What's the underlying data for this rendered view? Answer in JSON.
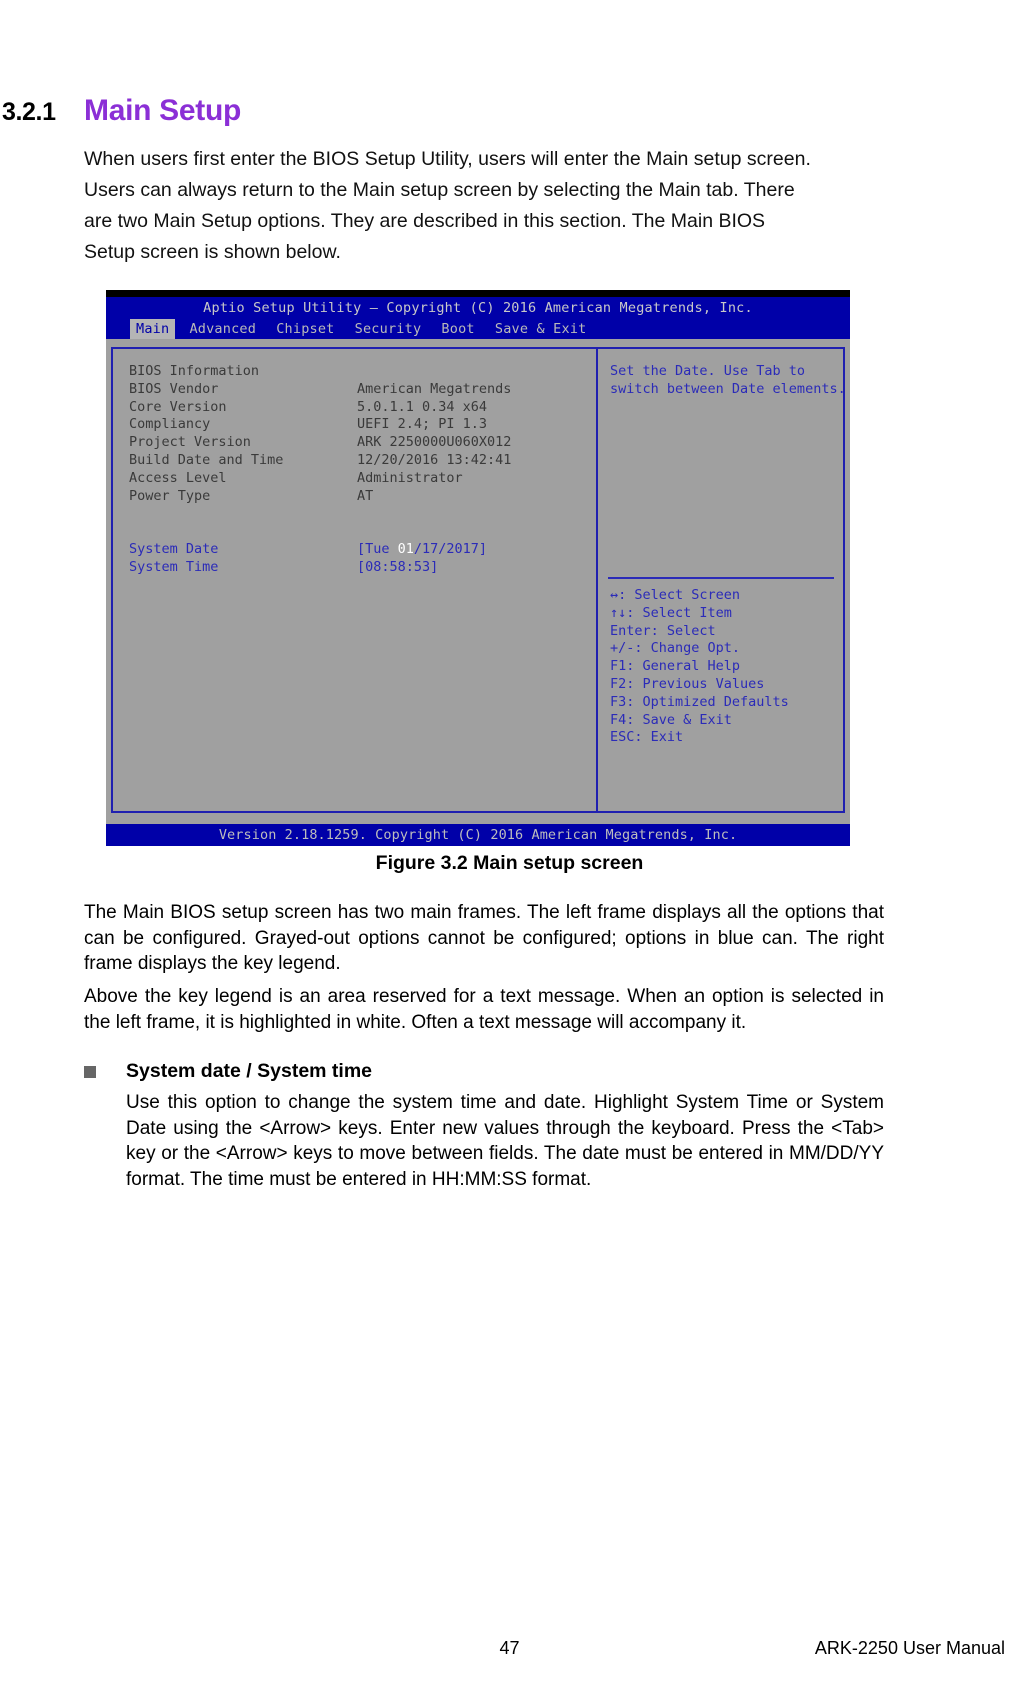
{
  "section": {
    "number": "3.2.1",
    "title": "Main Setup",
    "accent_color": "#8b2fd6",
    "intro_lines": [
      "When users first enter the BIOS Setup Utility, users will enter the Main setup screen.",
      "Users can always return to the Main setup screen by selecting the Main tab. There",
      "are two Main Setup options. They are described in this section. The Main BIOS",
      "Setup screen is shown below."
    ]
  },
  "bios": {
    "title": "Aptio Setup Utility – Copyright (C) 2016 American Megatrends, Inc.",
    "tabs": [
      {
        "label": "Main",
        "active": true
      },
      {
        "label": "Advanced",
        "active": false
      },
      {
        "label": "Chipset",
        "active": false
      },
      {
        "label": "Security",
        "active": false
      },
      {
        "label": "Boot",
        "active": false
      },
      {
        "label": "Save & Exit",
        "active": false
      }
    ],
    "info_heading": "BIOS Information",
    "info_rows": [
      {
        "label": "BIOS Vendor",
        "value": "American Megatrends"
      },
      {
        "label": "Core Version",
        "value": "5.0.1.1   0.34 x64"
      },
      {
        "label": "Compliancy",
        "value": "UEFI 2.4; PI 1.3"
      },
      {
        "label": "Project Version",
        "value": "ARK 2250000U060X012"
      },
      {
        "label": "Build Date and Time",
        "value": "12/20/2016 13:42:41"
      },
      {
        "label": "Access Level",
        "value": "Administrator"
      },
      {
        "label": "Power Type",
        "value": "AT"
      }
    ],
    "system_date": {
      "label": "System Date",
      "value_prefix": "[Tue ",
      "value_highlight": "01",
      "value_suffix": "/17/2017]"
    },
    "system_time": {
      "label": "System Time",
      "value": "[08:58:53]"
    },
    "help_lines": [
      "Set the Date. Use Tab to",
      "switch between Date elements."
    ],
    "legend": [
      "↔: Select Screen",
      "↑↓: Select Item",
      "Enter: Select",
      "+/-: Change Opt.",
      "F1: General Help",
      "F2: Previous Values",
      "F3: Optimized Defaults",
      "F4: Save & Exit",
      "ESC: Exit"
    ],
    "footer": "Version 2.18.1259. Copyright (C) 2016 American Megatrends, Inc.",
    "colors": {
      "bar_blue": "#0000a8",
      "panel_gray": "#a0a0a0",
      "editable_blue": "#2b2bb8",
      "static_gray": "#3a3a3a"
    }
  },
  "figure": {
    "caption": "Figure 3.2 Main setup screen"
  },
  "body": {
    "paragraph_1": "The Main BIOS setup screen has two main frames. The left frame displays all the options that can be configured. Grayed-out options cannot be configured; options in blue can. The right frame displays the key legend.",
    "paragraph_2": "Above the key legend is an area reserved for a text message. When an option is selected in the left frame, it is highlighted in white. Often a text message will accompany it.",
    "bullet_title": "System date / System time",
    "bullet_body": "Use this option to change the system time and date. Highlight System Time or System Date using the <Arrow> keys. Enter new values through the keyboard. Press the <Tab> key or the <Arrow> keys to move between fields. The date must be entered in MM/DD/YY format. The time must be entered in HH:MM:SS format."
  },
  "page_footer": {
    "page_number": "47",
    "manual_title": "ARK-2250 User Manual"
  }
}
